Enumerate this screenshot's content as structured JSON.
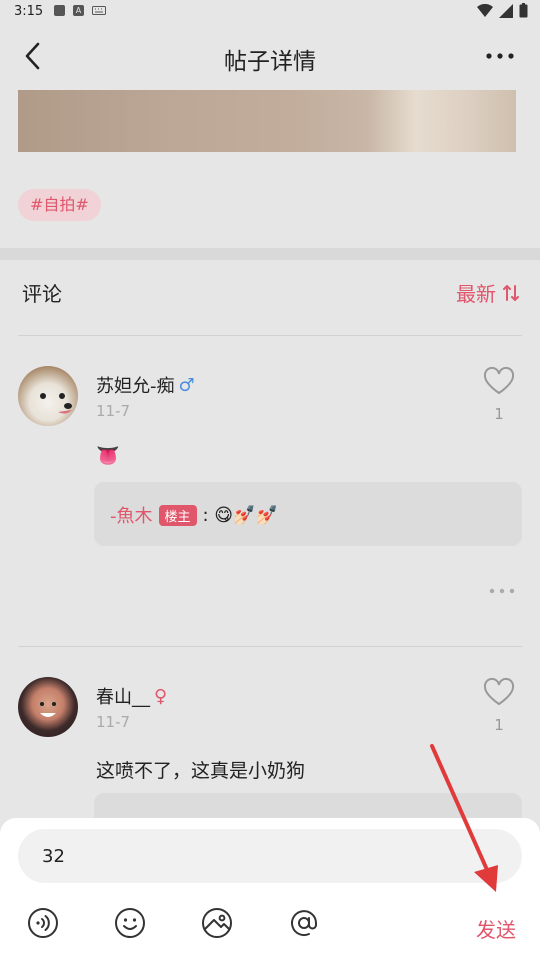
{
  "status_bar": {
    "time": "3:15",
    "a_icon_letter": "A"
  },
  "header": {
    "title": "帖子详情"
  },
  "post": {
    "tag": "#自拍#"
  },
  "comments_section": {
    "title": "评论",
    "sort_label": "最新"
  },
  "comments": [
    {
      "username": "苏妲允-痴",
      "gender": "♂",
      "date": "11-7",
      "likes": "1",
      "body": "👅",
      "reply": {
        "author": "-魚木",
        "badge": "楼主",
        "text": ": 😋💅🏻💅🏻"
      }
    },
    {
      "username": "春山__",
      "gender": "♀",
      "date": "11-7",
      "likes": "1",
      "body": "这喷不了，这真是小奶狗"
    }
  ],
  "composer": {
    "input_value": "32",
    "send_label": "发送"
  },
  "colors": {
    "accent": "#e0566b",
    "male": "#4a8fe0",
    "annotation_arrow": "#e03a3a"
  }
}
